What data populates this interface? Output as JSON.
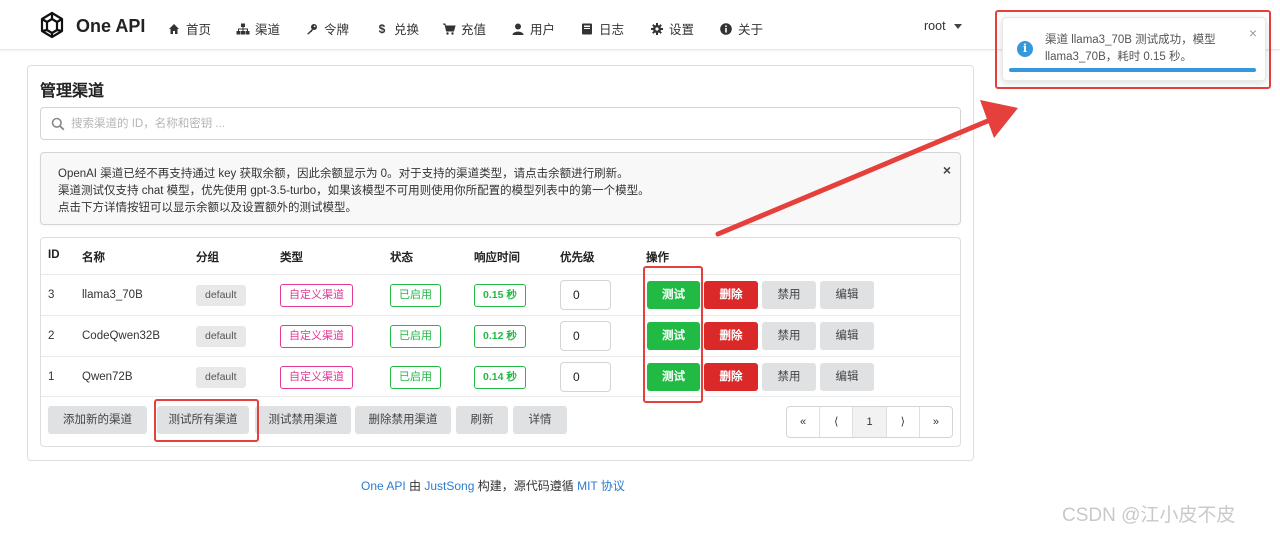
{
  "nav": {
    "brand": "One API",
    "items": [
      {
        "label": "首页",
        "icon": "home-icon"
      },
      {
        "label": "渠道",
        "icon": "sitemap-icon"
      },
      {
        "label": "令牌",
        "icon": "key-icon"
      },
      {
        "label": "兑换",
        "icon": "dollar-icon"
      },
      {
        "label": "充值",
        "icon": "cart-icon"
      },
      {
        "label": "用户",
        "icon": "user-icon"
      },
      {
        "label": "日志",
        "icon": "book-icon"
      },
      {
        "label": "设置",
        "icon": "gear-icon"
      },
      {
        "label": "关于",
        "icon": "info-icon"
      }
    ],
    "user": "root"
  },
  "page": {
    "title": "管理渠道",
    "search_placeholder": "搜索渠道的 ID，名称和密钥 ..."
  },
  "notice": {
    "lines": [
      "OpenAI 渠道已经不再支持通过 key 获取余额，因此余额显示为 0。对于支持的渠道类型，请点击余额进行刷新。",
      "渠道测试仅支持 chat 模型，优先使用 gpt-3.5-turbo，如果该模型不可用则使用你所配置的模型列表中的第一个模型。",
      "点击下方详情按钮可以显示余额以及设置额外的测试模型。"
    ],
    "close": "×"
  },
  "table": {
    "headers": [
      "ID",
      "名称",
      "分组",
      "类型",
      "状态",
      "响应时间",
      "优先级",
      "操作"
    ],
    "rows": [
      {
        "id": "3",
        "name": "llama3_70B",
        "group": "default",
        "type": "自定义渠道",
        "status": "已启用",
        "time": "0.15 秒",
        "priority": "0"
      },
      {
        "id": "2",
        "name": "CodeQwen32B",
        "group": "default",
        "type": "自定义渠道",
        "status": "已启用",
        "time": "0.12 秒",
        "priority": "0"
      },
      {
        "id": "1",
        "name": "Qwen72B",
        "group": "default",
        "type": "自定义渠道",
        "status": "已启用",
        "time": "0.14 秒",
        "priority": "0"
      }
    ],
    "actions": {
      "test": "测试",
      "delete": "删除",
      "disable": "禁用",
      "edit": "编辑"
    }
  },
  "footer_buttons": {
    "add": "添加新的渠道",
    "test_all": "测试所有渠道",
    "test_disabled": "测试禁用渠道",
    "delete_disabled": "删除禁用渠道",
    "refresh": "刷新",
    "details": "详情"
  },
  "pagination": {
    "first": "«",
    "prev": "⟨",
    "current": "1",
    "next": "⟩",
    "last": "»"
  },
  "footer": {
    "one_api": "One API",
    "by": " 由 ",
    "author": "JustSong",
    "built": " 构建，源代码遵循 ",
    "license": "MIT 协议"
  },
  "toast": {
    "message": "渠道 llama3_70B 测试成功，模型 llama3_70B，耗时 0.15 秒。",
    "close": "×",
    "progress": 0.98
  },
  "watermark": "CSDN @江小皮不皮",
  "colors": {
    "green": "#21ba45",
    "red": "#db2828",
    "pink": "#e03997",
    "info_blue": "#3498db",
    "highlight_red": "#e5403b"
  }
}
